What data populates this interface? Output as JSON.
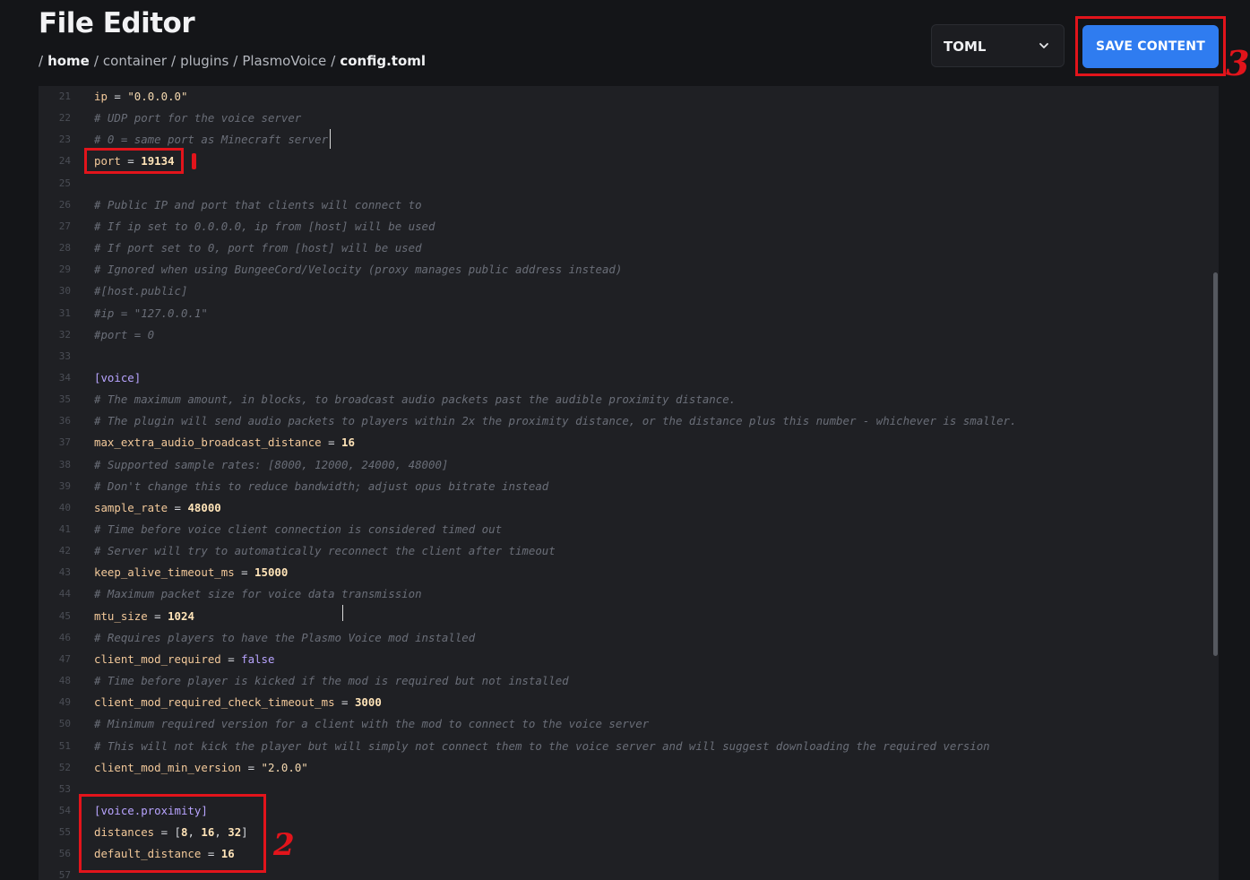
{
  "header": {
    "title": "File Editor"
  },
  "breadcrumb": [
    {
      "label": "home",
      "key": "home"
    },
    {
      "label": "container",
      "key": "container"
    },
    {
      "label": "plugins",
      "key": "plugins"
    },
    {
      "label": "PlasmoVoice",
      "key": "plasmovoice"
    },
    {
      "label": "config.toml",
      "key": "file"
    }
  ],
  "breadcrumb_separator": "/",
  "language_select": {
    "value": "TOML"
  },
  "toolbar": {
    "save_label": "SAVE CONTENT"
  },
  "editor": {
    "lines": [
      {
        "n": "21",
        "segs": [
          [
            "key",
            "ip"
          ],
          [
            "op",
            " = "
          ],
          [
            "str",
            "\"0.0.0.0\""
          ]
        ]
      },
      {
        "n": "22",
        "segs": [
          [
            "comment",
            "# UDP port for the voice server"
          ]
        ]
      },
      {
        "n": "23",
        "segs": [
          [
            "comment",
            "# 0 = same port as Minecraft server"
          ]
        ]
      },
      {
        "n": "24",
        "segs": [
          [
            "key",
            "port"
          ],
          [
            "op",
            " = "
          ],
          [
            "num",
            "19134"
          ]
        ]
      },
      {
        "n": "25",
        "segs": []
      },
      {
        "n": "26",
        "segs": [
          [
            "comment",
            "# Public IP and port that clients will connect to"
          ]
        ]
      },
      {
        "n": "27",
        "segs": [
          [
            "comment",
            "# If ip set to 0.0.0.0, ip from [host] will be used"
          ]
        ]
      },
      {
        "n": "28",
        "segs": [
          [
            "comment",
            "# If port set to 0, port from [host] will be used"
          ]
        ]
      },
      {
        "n": "29",
        "segs": [
          [
            "comment",
            "# Ignored when using BungeeCord/Velocity (proxy manages public address instead)"
          ]
        ]
      },
      {
        "n": "30",
        "segs": [
          [
            "comment",
            "#[host.public]"
          ]
        ]
      },
      {
        "n": "31",
        "segs": [
          [
            "comment",
            "#ip = \"127.0.0.1\""
          ]
        ]
      },
      {
        "n": "32",
        "segs": [
          [
            "comment",
            "#port = 0"
          ]
        ]
      },
      {
        "n": "33",
        "segs": []
      },
      {
        "n": "34",
        "segs": [
          [
            "sect",
            "[voice]"
          ]
        ]
      },
      {
        "n": "35",
        "segs": [
          [
            "comment",
            "# The maximum amount, in blocks, to broadcast audio packets past the audible proximity distance."
          ]
        ]
      },
      {
        "n": "36",
        "segs": [
          [
            "comment",
            "# The plugin will send audio packets to players within 2x the proximity distance, or the distance plus this number - whichever is smaller."
          ]
        ]
      },
      {
        "n": "37",
        "segs": [
          [
            "key",
            "max_extra_audio_broadcast_distance"
          ],
          [
            "op",
            " = "
          ],
          [
            "num",
            "16"
          ]
        ]
      },
      {
        "n": "38",
        "segs": [
          [
            "comment",
            "# Supported sample rates: [8000, 12000, 24000, 48000]"
          ]
        ]
      },
      {
        "n": "39",
        "segs": [
          [
            "comment",
            "# Don't change this to reduce bandwidth; adjust opus bitrate instead"
          ]
        ]
      },
      {
        "n": "40",
        "segs": [
          [
            "key",
            "sample_rate"
          ],
          [
            "op",
            " = "
          ],
          [
            "num",
            "48000"
          ]
        ]
      },
      {
        "n": "41",
        "segs": [
          [
            "comment",
            "# Time before voice client connection is considered timed out"
          ]
        ]
      },
      {
        "n": "42",
        "segs": [
          [
            "comment",
            "# Server will try to automatically reconnect the client after timeout"
          ]
        ]
      },
      {
        "n": "43",
        "segs": [
          [
            "key",
            "keep_alive_timeout_ms"
          ],
          [
            "op",
            " = "
          ],
          [
            "num",
            "15000"
          ]
        ]
      },
      {
        "n": "44",
        "segs": [
          [
            "comment",
            "# Maximum packet size for voice data transmission"
          ]
        ]
      },
      {
        "n": "45",
        "segs": [
          [
            "key",
            "mtu_size"
          ],
          [
            "op",
            " = "
          ],
          [
            "num",
            "1024"
          ]
        ]
      },
      {
        "n": "46",
        "segs": [
          [
            "comment",
            "# Requires players to have the Plasmo Voice mod installed"
          ]
        ]
      },
      {
        "n": "47",
        "segs": [
          [
            "key",
            "client_mod_required"
          ],
          [
            "op",
            " = "
          ],
          [
            "bool",
            "false"
          ]
        ]
      },
      {
        "n": "48",
        "segs": [
          [
            "comment",
            "# Time before player is kicked if the mod is required but not installed"
          ]
        ]
      },
      {
        "n": "49",
        "segs": [
          [
            "key",
            "client_mod_required_check_timeout_ms"
          ],
          [
            "op",
            " = "
          ],
          [
            "num",
            "3000"
          ]
        ]
      },
      {
        "n": "50",
        "segs": [
          [
            "comment",
            "# Minimum required version for a client with the mod to connect to the voice server"
          ]
        ]
      },
      {
        "n": "51",
        "segs": [
          [
            "comment",
            "# This will not kick the player but will simply not connect them to the voice server and will suggest downloading the required version"
          ]
        ]
      },
      {
        "n": "52",
        "segs": [
          [
            "key",
            "client_mod_min_version"
          ],
          [
            "op",
            " = "
          ],
          [
            "str",
            "\"2.0.0\""
          ]
        ]
      },
      {
        "n": "53",
        "segs": []
      },
      {
        "n": "54",
        "segs": [
          [
            "sect",
            "[voice.proximity]"
          ]
        ]
      },
      {
        "n": "55",
        "segs": [
          [
            "key",
            "distances"
          ],
          [
            "op",
            " = "
          ],
          [
            "punct",
            "["
          ],
          [
            "num",
            "8"
          ],
          [
            "punct",
            ", "
          ],
          [
            "num",
            "16"
          ],
          [
            "punct",
            ", "
          ],
          [
            "num",
            "32"
          ],
          [
            "punct",
            "]"
          ]
        ]
      },
      {
        "n": "56",
        "segs": [
          [
            "key",
            "default_distance"
          ],
          [
            "op",
            " = "
          ],
          [
            "num",
            "16"
          ]
        ]
      },
      {
        "n": "57",
        "segs": []
      }
    ]
  },
  "annotations": [
    "1",
    "2",
    "3"
  ],
  "colors": {
    "accent": "#2f7cf0",
    "annotation": "#e2141b",
    "background": "#141518",
    "editor_bg": "#1f2024"
  },
  "icons": {
    "select_chevron": "chevron-down-icon"
  }
}
